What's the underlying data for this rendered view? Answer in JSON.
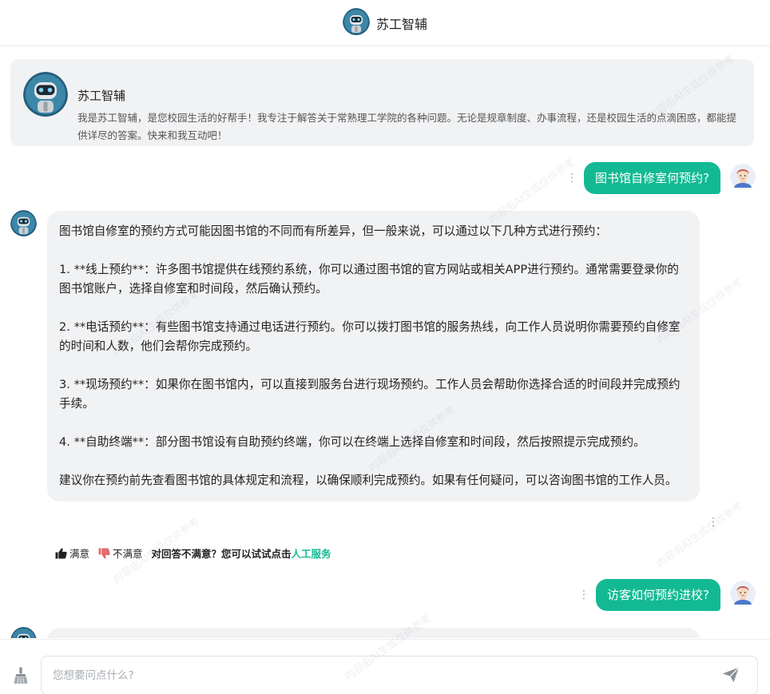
{
  "app": {
    "title": "苏工智辅"
  },
  "welcome": {
    "title": "苏工智辅",
    "text": "我是苏工智辅，是您校园生活的好帮手！我专注于解答关于常熟理工学院的各种问题。无论是规章制度、办事流程，还是校园生活的点滴困惑，都能提供详尽的答案。快来和我互动吧！"
  },
  "messages": [
    {
      "role": "user",
      "text": "图书馆自修室何预约?"
    },
    {
      "role": "bot",
      "paragraphs": [
        "图书馆自修室的预约方式可能因图书馆的不同而有所差异，但一般来说，可以通过以下几种方式进行预约：",
        "1. **线上预约**：许多图书馆提供在线预约系统，你可以通过图书馆的官方网站或相关APP进行预约。通常需要登录你的图书馆账户，选择自修室和时间段，然后确认预约。",
        "2. **电话预约**：有些图书馆支持通过电话进行预约。你可以拨打图书馆的服务热线，向工作人员说明你需要预约自修室的时间和人数，他们会帮你完成预约。",
        "3. **现场预约**：如果你在图书馆内，可以直接到服务台进行现场预约。工作人员会帮助你选择合适的时间段并完成预约手续。",
        "4. **自助终端**：部分图书馆设有自助预约终端，你可以在终端上选择自修室和时间段，然后按照提示完成预约。",
        "建议你在预约前先查看图书馆的具体规定和流程，以确保顺利完成预约。如果有任何疑问，可以咨询图书馆的工作人员。"
      ]
    },
    {
      "role": "user",
      "text": "访客如何预约进校?"
    }
  ],
  "feedback": {
    "satisfied": "满意",
    "unsatisfied": "不满意",
    "tip": "对回答不满意？您可以试试点击",
    "link": "人工服务"
  },
  "input": {
    "placeholder": "您想要问点什么?",
    "value": ""
  },
  "watermark": "内容由AI生成仅供参考",
  "colors": {
    "accent": "#13b993",
    "bubble_bg": "#f1f2f4",
    "dislike": "#e56b6b"
  },
  "icons": {
    "bot_avatar": "robot-avatar-icon",
    "user_avatar": "user-avatar-icon",
    "like": "thumbs-up-icon",
    "dislike": "thumbs-down-icon",
    "more": "more-vertical-icon",
    "clean": "broom-icon",
    "send": "send-icon"
  }
}
